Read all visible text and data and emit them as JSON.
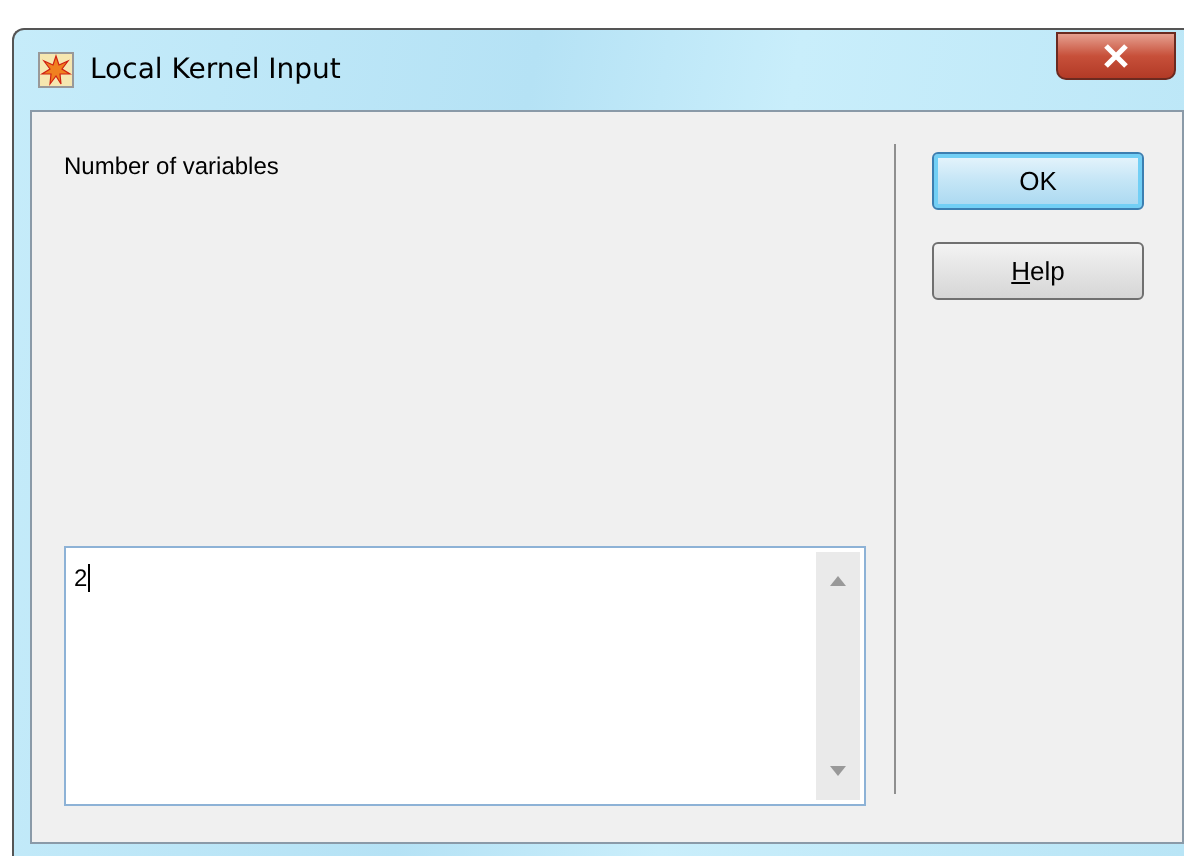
{
  "window": {
    "title": "Local Kernel Input"
  },
  "prompt": "Number of variables",
  "input": {
    "value": "2"
  },
  "buttons": [
    {
      "label": "OK",
      "default": true
    },
    {
      "label": "Help",
      "first_letter_underlined": true,
      "default": false
    }
  ]
}
